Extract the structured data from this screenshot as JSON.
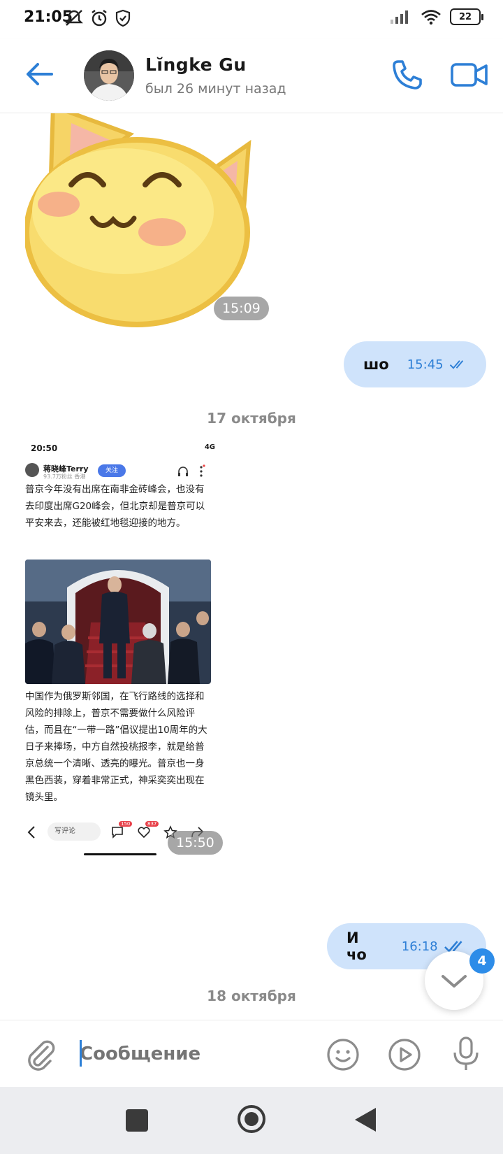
{
  "status_bar": {
    "time": "21:05",
    "battery": "22"
  },
  "header": {
    "name": "Lĭngke Gu",
    "status": "был 26 минут назад"
  },
  "messages": {
    "sticker_time": "15:09",
    "out1": {
      "text": "шо",
      "time": "15:45"
    },
    "date1": "17 октября",
    "image_time": "15:50",
    "out2": {
      "text": "И чо",
      "time": "16:18"
    },
    "date2": "18 октября"
  },
  "shared_screenshot": {
    "time": "20:50",
    "network": "4G",
    "author": "蒋晓峰Terry",
    "author_sub": "93.7万粉丝  香港",
    "follow": "关注",
    "paragraph1": "普京今年没有出席在南非金砖峰会，也没有去印度出席G20峰会，但北京却是普京可以平安来去，还能被红地毯迎接的地方。",
    "paragraph2": "中国作为俄罗斯邻国，在飞行路线的选择和风险的排除上，普京不需要做什么风险评估，而且在“一带一路”倡议提出10周年的大日子来捧场，中方自然投桃报李，就是给普京总统一个清晰、透亮的曝光。普京也一身黑色西装，穿着非常正式，神采奕奕出现在镜头里。",
    "comment_placeholder": "写评论",
    "comment_count": "150",
    "like_count": "837"
  },
  "scroll_badge": "4",
  "composer": {
    "placeholder": "Сообщение"
  },
  "colors": {
    "accent": "#2d7fd6",
    "bubble": "#cfe3fb",
    "badge": "#2d8ce8"
  }
}
